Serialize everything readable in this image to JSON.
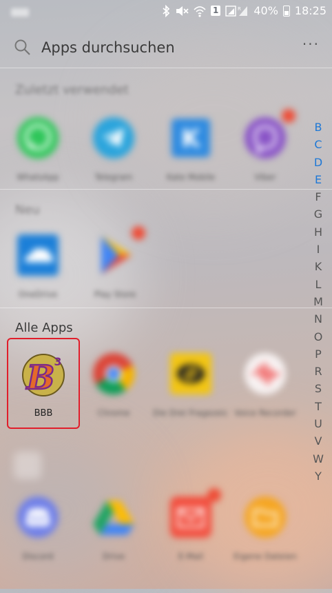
{
  "status_bar": {
    "icons": [
      "bluetooth-icon",
      "mute-icon",
      "wifi-icon",
      "signal-icon"
    ],
    "sim_slot": "1",
    "battery": "40%",
    "time": "18:25"
  },
  "search": {
    "placeholder": "Apps durchsuchen",
    "icon": "search-icon",
    "more_label": "⋮"
  },
  "sections": {
    "recent_label": "Zuletzt verwendet",
    "new_label": "Neu",
    "all_label": "Alle Apps"
  },
  "recent_apps": [
    {
      "name": "WhatsApp",
      "color": "#2fc65a"
    },
    {
      "name": "Telegram",
      "color": "#2aa4dc"
    },
    {
      "name": "Kate Mobile",
      "color": "#2d8ae0"
    },
    {
      "name": "Viber",
      "color": "#8a55c7"
    }
  ],
  "new_apps": [
    {
      "name": "OneDrive",
      "color": "#1b7fd8"
    },
    {
      "name": "Play Store",
      "color": "#34a853"
    }
  ],
  "all_apps": [
    {
      "name": "BBB"
    },
    {
      "name": "Chrome",
      "color": "#db4437"
    },
    {
      "name": "Die Drei Fragezeichen",
      "color": "#f2c513"
    },
    {
      "name": "Voice Recorder",
      "color": "#f04a4a"
    },
    {
      "name": "Discord",
      "color": "#6f7fe8"
    },
    {
      "name": "Drive",
      "color": "#1fa463"
    },
    {
      "name": "E-Mail",
      "color": "#f24e3e"
    },
    {
      "name": "Eigene Dateien",
      "color": "#f5a623"
    }
  ],
  "alphabet": [
    "B",
    "C",
    "D",
    "E",
    "F",
    "G",
    "H",
    "I",
    "K",
    "L",
    "M",
    "N",
    "O",
    "P",
    "R",
    "S",
    "T",
    "U",
    "V",
    "W",
    "Y"
  ],
  "alphabet_active": [
    "B",
    "C",
    "D",
    "E"
  ],
  "colors": {
    "highlight": "#e11d2a",
    "index_active": "#1e78d6",
    "badge": "#ee4b35"
  }
}
